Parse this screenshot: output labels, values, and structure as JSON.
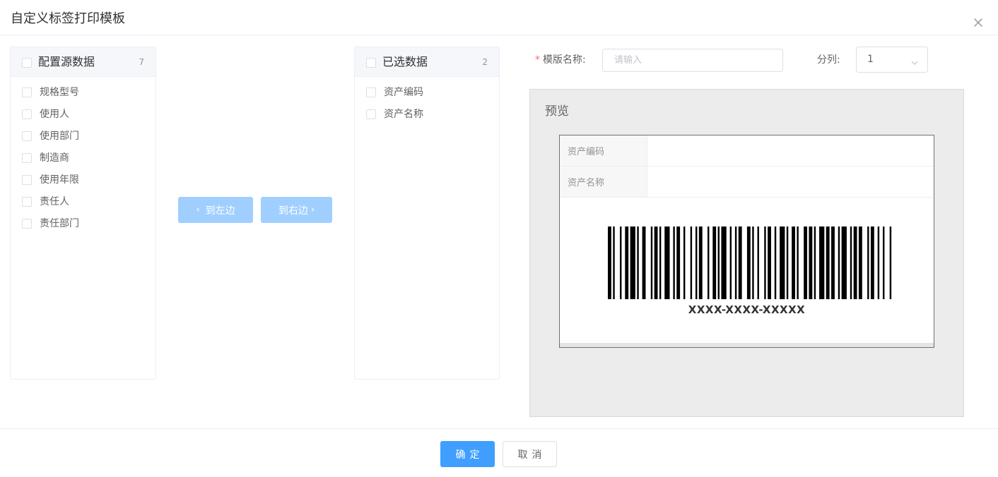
{
  "dialog": {
    "title": "自定义标签打印模板"
  },
  "source_panel": {
    "title": "配置源数据",
    "count": "7",
    "items": [
      {
        "label": "规格型号"
      },
      {
        "label": "使用人"
      },
      {
        "label": "使用部门"
      },
      {
        "label": "制造商"
      },
      {
        "label": "使用年限"
      },
      {
        "label": "责任人"
      },
      {
        "label": "责任部门"
      }
    ]
  },
  "target_panel": {
    "title": "已选数据",
    "count": "2",
    "items": [
      {
        "label": "资产编码"
      },
      {
        "label": "资产名称"
      }
    ]
  },
  "transfer": {
    "to_left_label": "到左边",
    "to_right_label": "到右边"
  },
  "form": {
    "template_name_label": "模版名称:",
    "template_name_placeholder": "请输入",
    "template_name_value": "",
    "columns_label": "分列:",
    "columns_value": "1"
  },
  "preview": {
    "title": "预览",
    "rows": [
      {
        "key": "资产编码",
        "value": ""
      },
      {
        "key": "资产名称",
        "value": ""
      }
    ],
    "barcode_text": "XXXX-XXXX-XXXXX"
  },
  "footer": {
    "confirm_label": "确定",
    "cancel_label": "取消"
  },
  "colors": {
    "primary": "#409eff",
    "primary_disabled": "#a0cfff",
    "required": "#f56c6c",
    "preview_bg": "#ececec"
  }
}
